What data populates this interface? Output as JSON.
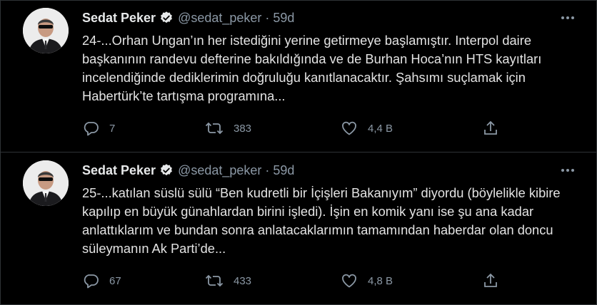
{
  "tweets": [
    {
      "author": "Sedat Peker",
      "handle": "@sedat_peker",
      "time": "59d",
      "text": "24-...Orhan Ungan’ın her istediğini yerine getirmeye başlamıştır. Interpol daire başkanının randevu defterine bakıldığında ve de Burhan Hoca’nın HTS kayıtları incelendiğinde dediklerimin doğruluğu kanıtlanacaktır. Şahsımı suçlamak için Habertürk’te tartışma programına...",
      "replies": "7",
      "retweets": "383",
      "likes": "4,4 B"
    },
    {
      "author": "Sedat Peker",
      "handle": "@sedat_peker",
      "time": "59d",
      "text": "25-...katılan süslü sülü “Ben kudretli bir İçişleri Bakanıyım” diyordu (böylelikle kibire kapılıp en büyük günahlardan birini işledi). İşin en komik yanı ise şu ana kadar anlattıklarım ve bundan sonra anlatacaklarımın tamamından haberdar olan doncu süleymanın Ak Parti’de...",
      "replies": "67",
      "retweets": "433",
      "likes": "4,8 B"
    }
  ],
  "separator": "·",
  "colors": {
    "background": "#000000",
    "text": "#e3e3e3",
    "muted": "#8b98a5",
    "divider": "#2f3336",
    "verified_badge": "#e7e9ea"
  },
  "icons": {
    "reply": "reply-icon",
    "retweet": "retweet-icon",
    "like": "heart-icon",
    "share": "share-icon",
    "more": "more-icon",
    "verified": "verified-badge-icon"
  }
}
